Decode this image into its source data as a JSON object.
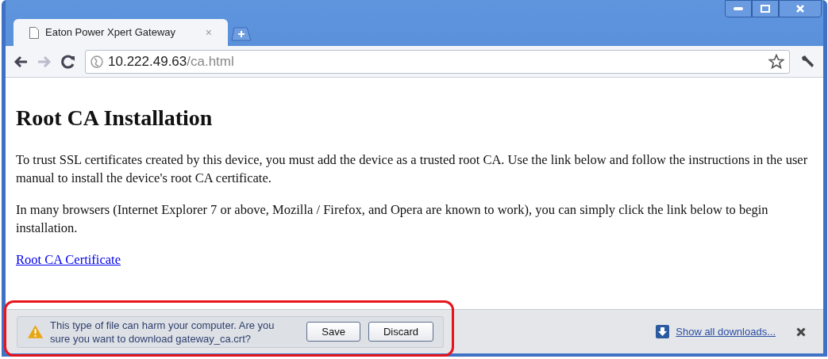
{
  "tab": {
    "title": "Eaton Power Xpert Gateway",
    "close": "×",
    "selected": true
  },
  "address": {
    "host": "10.222.49.63",
    "path": "/ca.html"
  },
  "page": {
    "heading": "Root CA Installation",
    "paragraphs": [
      "To trust SSL certificates created by this device, you must add the device as a trusted root CA. Use the link below and follow the instructions in the user manual to install the device's root CA certificate.",
      "In many browsers (Internet Explorer 7 or above, Mozilla / Firefox, and Opera are known to work), you can simply click the link below to begin installation."
    ],
    "link": "Root CA Certificate"
  },
  "download_bar": {
    "warning": "This type of file can harm your computer. Are you sure you want to download gateway_ca.crt?",
    "buttons": [
      "Save",
      "Discard"
    ],
    "show_all": "Show all downloads...",
    "highlighted": true
  }
}
